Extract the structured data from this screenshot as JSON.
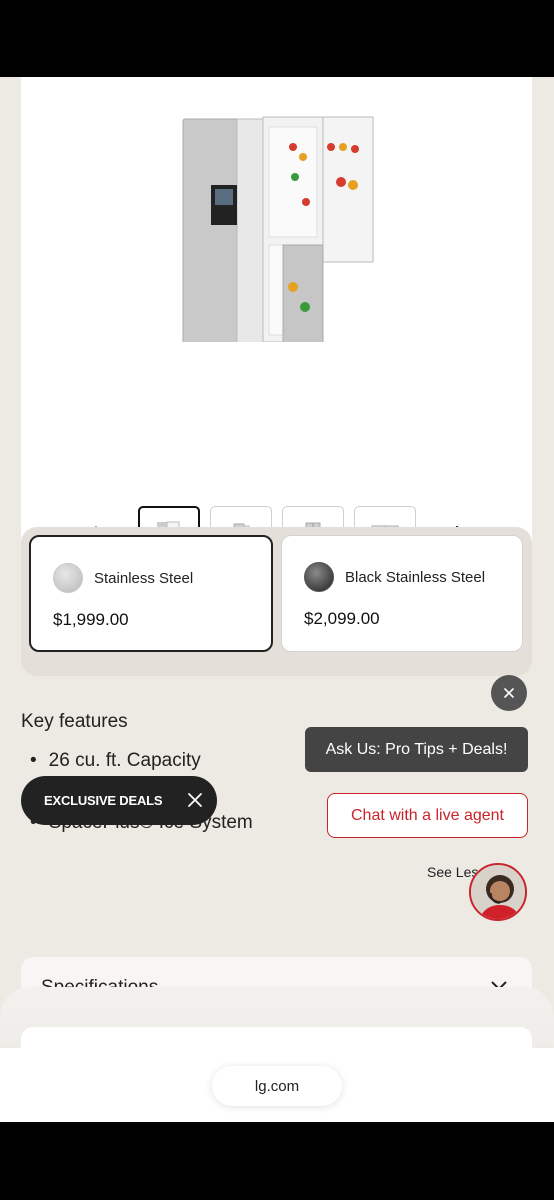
{
  "gallery": {
    "prev_icon": "arrow-left-icon",
    "next_icon": "arrow-right-icon",
    "thumbnails": 4,
    "selected_index": 0
  },
  "options": [
    {
      "name": "Stainless Steel",
      "price": "$1,999.00",
      "selected": true,
      "swatch": "#c8c8c8"
    },
    {
      "name": "Black Stainless Steel",
      "price": "$2,099.00",
      "selected": false,
      "swatch": "#2a2a2a"
    }
  ],
  "key_features": {
    "title": "Key features",
    "items": [
      "26 cu. ft. Capacity",
      "",
      "SpacePlus® Ice System"
    ]
  },
  "promo": {
    "label": "EXCLUSIVE DEALS"
  },
  "chat": {
    "ask_us": "Ask Us: Pro Tips + Deals!",
    "live_agent": "Chat with a live agent",
    "see_less": "See Les"
  },
  "specifications": {
    "title": "Specifications"
  },
  "browser": {
    "url": "lg.com"
  },
  "colors": {
    "brand_red": "#c9242b",
    "dark_pill": "#222222"
  }
}
